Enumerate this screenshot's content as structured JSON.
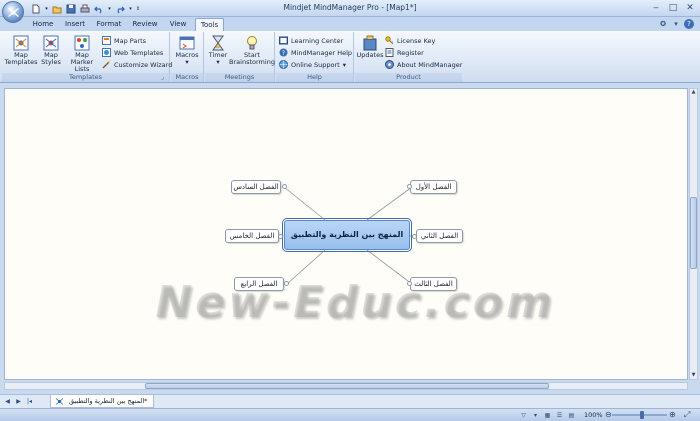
{
  "window": {
    "title": "Mindjet MindManager Pro - [Map1*]"
  },
  "tabs": [
    "Home",
    "Insert",
    "Format",
    "Review",
    "View",
    "Tools"
  ],
  "active_tab": "Tools",
  "ribbon": {
    "templates": {
      "label": "Templates",
      "map_templates": "Map Templates",
      "map_templates_l1": "Map",
      "map_templates_l2": "Templates",
      "map_styles_l1": "Map",
      "map_styles_l2": "Styles",
      "map_marker_l1": "Map Marker",
      "map_marker_l2": "Lists",
      "map_parts": "Map Parts",
      "web_templates": "Web Templates",
      "customize_wizard": "Customize Wizard"
    },
    "macros": {
      "label": "Macros",
      "button": "Macros"
    },
    "meetings": {
      "label": "Meetings",
      "timer": "Timer",
      "start_l1": "Start",
      "start_l2": "Brainstorming"
    },
    "help": {
      "label": "Help",
      "learning_center": "Learning Center",
      "mm_help": "MindManager Help",
      "online_support": "Online Support"
    },
    "product": {
      "label": "Product",
      "updates": "Updates",
      "license_key": "License Key",
      "register": "Register",
      "about": "About MindManager"
    }
  },
  "map": {
    "central": "المنهج بين النظرية والتطبيق",
    "topics": {
      "ch1": "الفصل الأول",
      "ch2": "الفصل الثاني",
      "ch3": "الفصل الثالث",
      "ch4": "الفصل الرابع",
      "ch5": "الفصل الخامس",
      "ch6": "الفصل السادس"
    }
  },
  "watermark": "New-Educ.com",
  "document_tab": "المنهج بين النظرية والتطبيق*",
  "status": {
    "zoom": "100%"
  },
  "colors": {
    "ribbon_bg": "#dbe6f5",
    "central_fill": "#a9caf2",
    "canvas_bg": "#fefdf7"
  }
}
